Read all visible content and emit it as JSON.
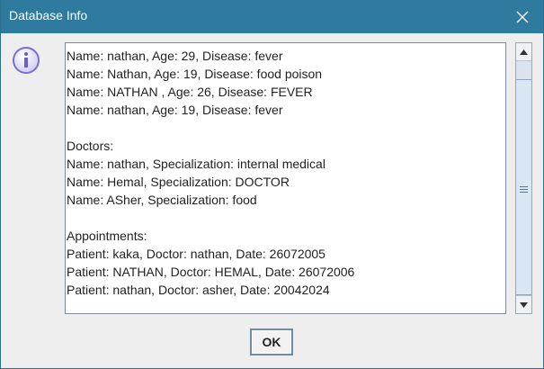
{
  "window": {
    "title": "Database Info"
  },
  "dialog": {
    "icon": "info-icon",
    "lines": [
      "Name: nathan, Age: 29, Disease: fever",
      "Name: Nathan, Age: 19, Disease: food poison",
      "Name: NATHAN , Age: 26, Disease: FEVER",
      "Name: nathan, Age: 19, Disease: fever",
      "",
      "Doctors:",
      "Name: nathan, Specialization: internal medical",
      "Name: Hemal, Specialization: DOCTOR",
      "Name: ASher, Specialization: food",
      "",
      "Appointments:",
      "Patient: kaka, Doctor: nathan, Date: 26072005",
      "Patient: NATHAN, Doctor: HEMAL, Date: 26072006",
      "Patient: nathan, Doctor: asher, Date: 20042024"
    ],
    "ok_label": "OK"
  },
  "colors": {
    "titlebar": "#2f7ba0",
    "background": "#eeeeee",
    "icon": "#7a6fd0"
  }
}
